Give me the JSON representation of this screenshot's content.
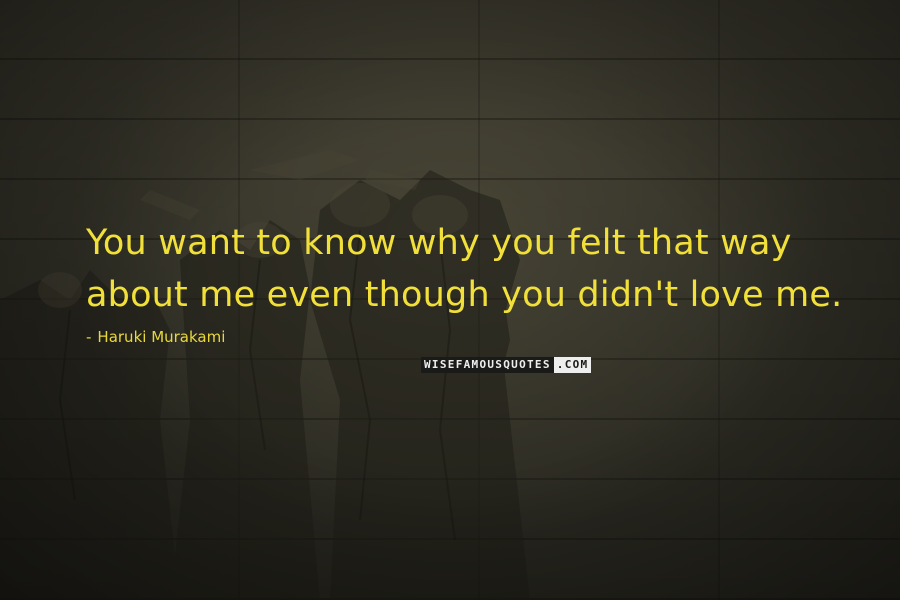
{
  "quote": {
    "line1": "You want to know why you felt that way",
    "line2": "about me even though you didn't love me."
  },
  "author": {
    "dash": "-",
    "name": "Haruki Murakami"
  },
  "watermark": {
    "part1": "WISEFAMOUSQUOTES",
    "part2": ".COM"
  },
  "colors": {
    "quote_text": "#f2e03a",
    "background": "#2f2e25"
  }
}
